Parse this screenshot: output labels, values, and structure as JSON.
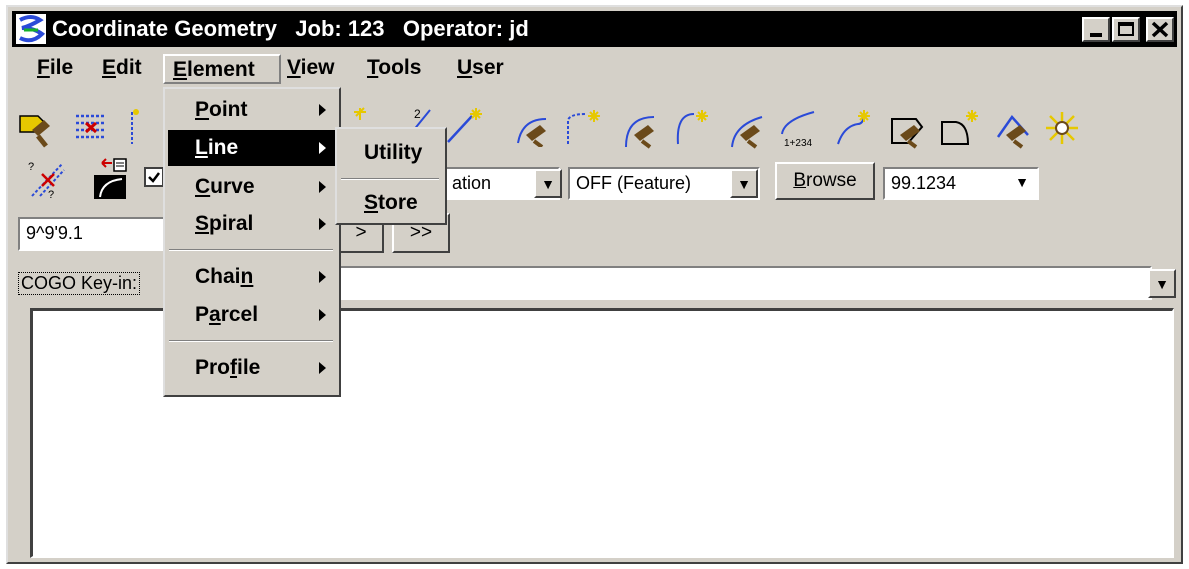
{
  "window": {
    "title": "Coordinate Geometry   Job: 123   Operator: jd",
    "minimize_label": "_",
    "maximize_label": "□",
    "close_label": "X"
  },
  "menubar": {
    "items": [
      {
        "label": "File",
        "mnemonic": "F",
        "rest": "ile"
      },
      {
        "label": "Edit",
        "mnemonic": "E",
        "rest": "dit"
      },
      {
        "label": "Element",
        "mnemonic": "E",
        "rest": "lement"
      },
      {
        "label": "View",
        "mnemonic": "V",
        "rest": "iew"
      },
      {
        "label": "Tools",
        "mnemonic": "T",
        "rest": "ools"
      },
      {
        "label": "User",
        "mnemonic": "U",
        "rest": "ser"
      }
    ]
  },
  "element_menu": {
    "items": [
      {
        "pre": "",
        "mnemonic": "P",
        "rest": "oint"
      },
      {
        "pre": "",
        "mnemonic": "L",
        "rest": "ine"
      },
      {
        "pre": "",
        "mnemonic": "C",
        "rest": "urve"
      },
      {
        "pre": "",
        "mnemonic": "S",
        "rest": "piral"
      },
      {
        "pre": "Chai",
        "mnemonic": "n",
        "rest": ""
      },
      {
        "pre": "P",
        "mnemonic": "a",
        "rest": "rcel"
      },
      {
        "pre": "Pro",
        "mnemonic": "f",
        "rest": "ile"
      }
    ],
    "selected": "Line"
  },
  "line_submenu": {
    "items": [
      {
        "pre": "Utility",
        "mnemonic": "",
        "rest": ""
      },
      {
        "pre": "",
        "mnemonic": "S",
        "rest": "tore"
      }
    ]
  },
  "toolbar": {
    "combo_station_value": "ation",
    "combo_feature_value": "OFF (Feature)",
    "browse_mnemonic": "B",
    "browse_rest": "rowse",
    "combo_precision_value": "99.1234",
    "angle_field_value": "9^9'9.1",
    "next_label": ">",
    "last_label": ">>"
  },
  "keyin": {
    "label": "COGO Key-in:",
    "value": ""
  },
  "icons": [
    "locate-point-icon",
    "list-points-icon",
    "store-point-icon",
    "point-by-distance-icon",
    "line-locate-icon",
    "line-store-icon",
    "curve-locate-icon",
    "curve-store-icon",
    "curve-pi-icon",
    "curve-pc-icon",
    "spiral-icon",
    "spiral-station-icon",
    "spiral-store-icon",
    "parcel-locate-icon",
    "parcel-store-icon",
    "chain-locate-icon",
    "chain-star-icon",
    "intersect-icon",
    "curve-dialog-icon"
  ],
  "colors": {
    "title_bg": "#000000",
    "window_bg": "#d4d0c8",
    "selected_bg": "#000000",
    "icon_brown": "#6b4a1a",
    "icon_red": "#cc0000",
    "icon_yellow": "#e6c800",
    "icon_blue": "#2a4ad8"
  }
}
